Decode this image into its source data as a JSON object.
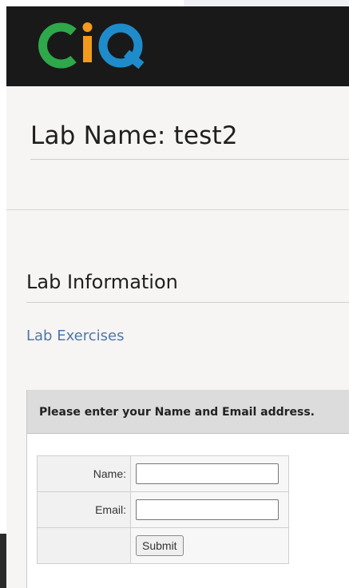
{
  "logo": {
    "text": "CIQ",
    "colors": [
      "#2ea84a",
      "#f39a1c",
      "#1e8ccb"
    ]
  },
  "lab": {
    "title": "Lab Name: test2"
  },
  "section": {
    "title": "Lab Information",
    "link_label": "Lab Exercises"
  },
  "form": {
    "heading": "Please enter your Name and Email address.",
    "name_label": "Name:",
    "name_value": "",
    "email_label": "Email:",
    "email_value": "",
    "submit_label": "Submit"
  },
  "colors": {
    "header_bg": "#191919",
    "page_bg": "#f6f5f3",
    "link": "#4e76a8",
    "panel_head": "#dcdcdc"
  }
}
